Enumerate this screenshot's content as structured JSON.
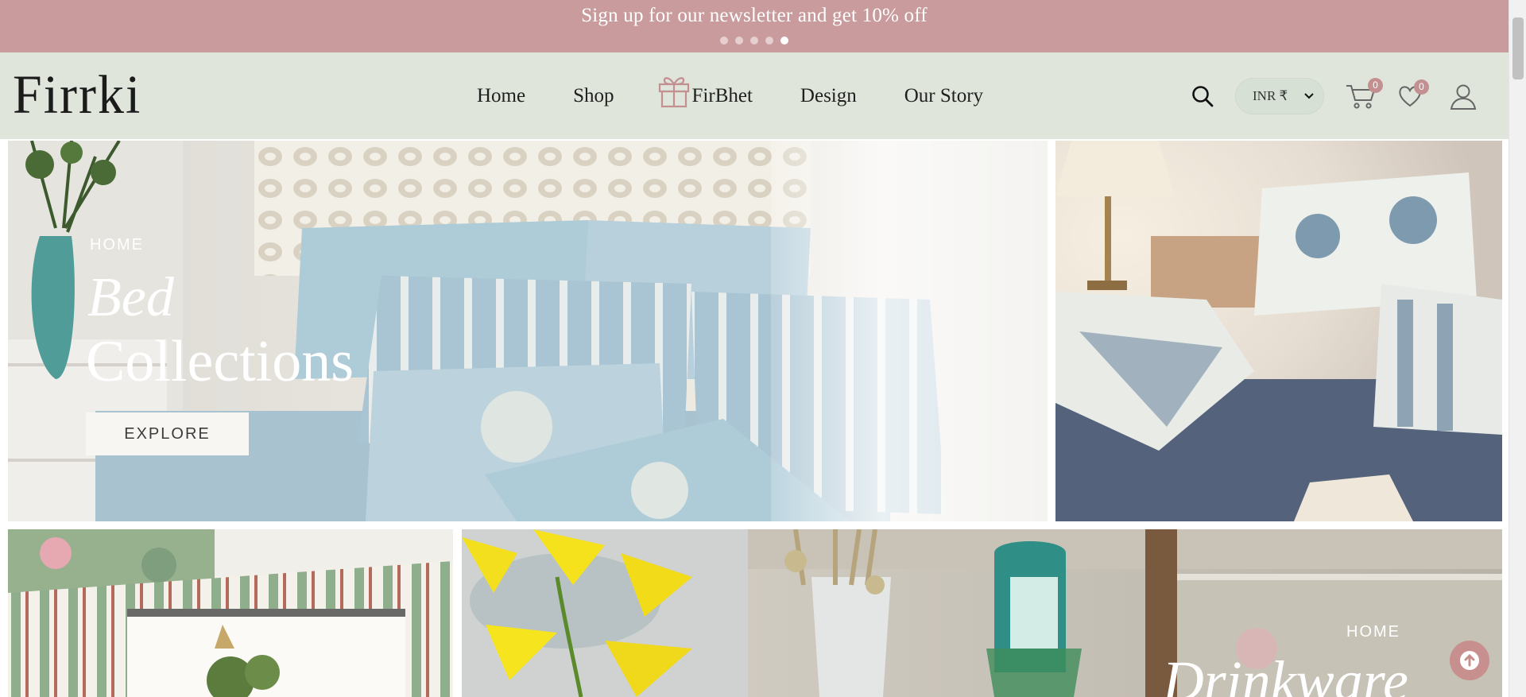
{
  "announcement": {
    "text": "Sign up for our newsletter and get 10% off",
    "slides": 5,
    "active_slide": 5
  },
  "brand": {
    "logo_text": "Firrki"
  },
  "nav": {
    "items": [
      {
        "label": "Home"
      },
      {
        "label": "Shop"
      },
      {
        "label": "FirBhet",
        "icon": "gift-icon"
      },
      {
        "label": "Design"
      },
      {
        "label": "Our Story"
      }
    ]
  },
  "header_tools": {
    "search_icon": "search-icon",
    "currency": "INR ₹",
    "cart_count": "0",
    "wishlist_count": "0",
    "account_icon": "user-icon"
  },
  "colors": {
    "announcement_bg": "#c99b9d",
    "header_bg": "#dfe5da",
    "badge": "#c48f91",
    "to_top": "#c7908f"
  },
  "hero": {
    "eyebrow": "HOME",
    "title_italic": "Bed",
    "title": "Collections",
    "cta": "EXPLORE"
  },
  "drinkware": {
    "eyebrow": "HOME",
    "title_italic": "Drinkware"
  },
  "scroll_to_top_icon": "arrow-up-icon"
}
